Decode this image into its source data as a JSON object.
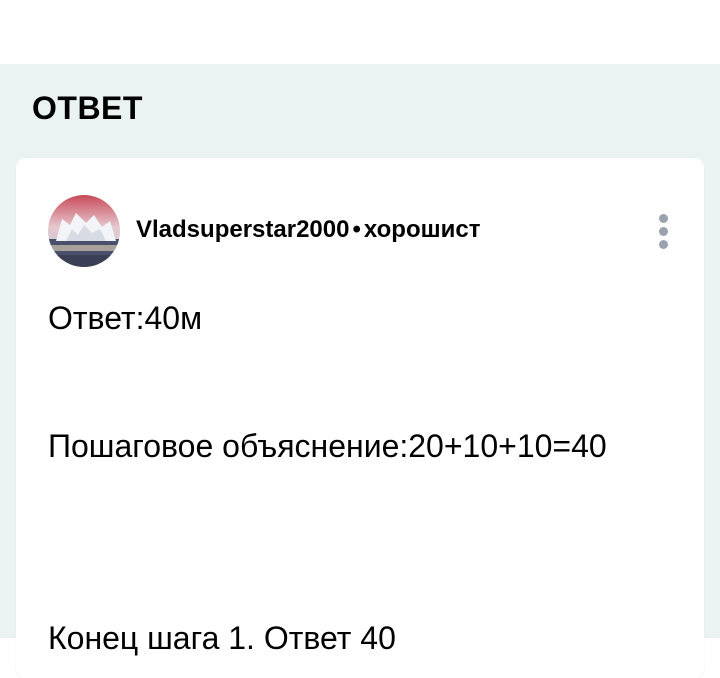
{
  "section": {
    "title": "ОТВЕТ"
  },
  "answer": {
    "author": {
      "name": "Vladsuperstar2000",
      "separator": "•",
      "rank": "хорошист",
      "avatar_icon": "avatar-photo"
    },
    "menu_icon": "more-vertical-icon",
    "lines": [
      "Ответ:40м",
      "Пошаговое объяснение:20+10+10=40",
      "Конец шага 1. Ответ 40"
    ]
  },
  "colors": {
    "section_background": "#ebf2f2",
    "card_background": "#ffffff",
    "text": "#000000",
    "menu_dots": "#9aa3ad"
  }
}
